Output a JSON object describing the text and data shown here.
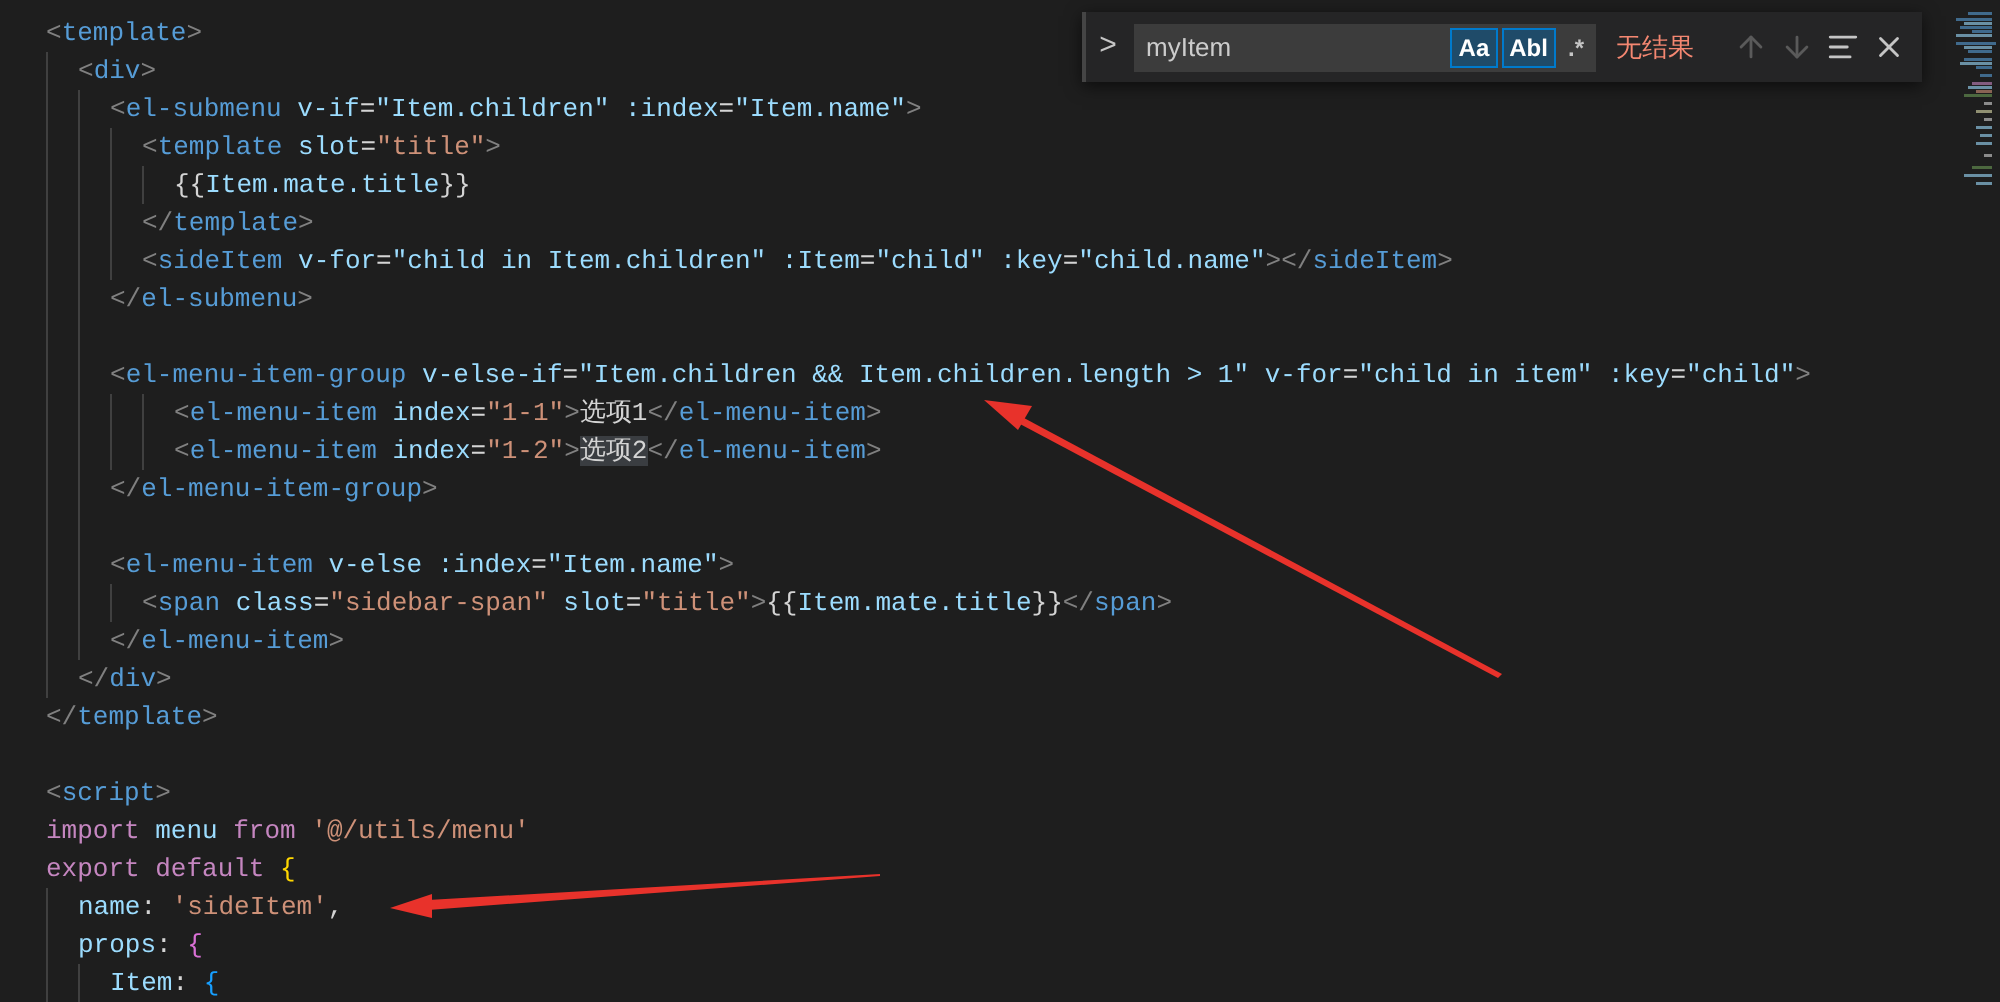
{
  "editor": {
    "lines": [
      {
        "tokens": [
          {
            "kind": "punct",
            "text": "<"
          },
          {
            "kind": "tag",
            "text": "template"
          },
          {
            "kind": "punct",
            "text": ">"
          }
        ],
        "children": [
          {
            "tokens": [
              {
                "kind": "punct",
                "text": "<"
              },
              {
                "kind": "tag",
                "text": "div"
              },
              {
                "kind": "punct",
                "text": ">"
              }
            ],
            "children": [
              {
                "tokens": [
                  {
                    "kind": "punct",
                    "text": "<"
                  },
                  {
                    "kind": "tag",
                    "text": "el-submenu"
                  },
                  {
                    "kind": "attr",
                    "text": " v-if"
                  },
                  {
                    "kind": "plain",
                    "text": "="
                  },
                  {
                    "kind": "expr",
                    "text": "\"Item.children\""
                  },
                  {
                    "kind": "attr",
                    "text": " :index"
                  },
                  {
                    "kind": "plain",
                    "text": "="
                  },
                  {
                    "kind": "expr",
                    "text": "\"Item.name\""
                  },
                  {
                    "kind": "punct",
                    "text": ">"
                  }
                ],
                "children": [
                  {
                    "tokens": [
                      {
                        "kind": "punct",
                        "text": "<"
                      },
                      {
                        "kind": "tag",
                        "text": "template"
                      },
                      {
                        "kind": "attr",
                        "text": " slot"
                      },
                      {
                        "kind": "plain",
                        "text": "="
                      },
                      {
                        "kind": "string",
                        "text": "\"title\""
                      },
                      {
                        "kind": "punct",
                        "text": ">"
                      }
                    ],
                    "children": [
                      {
                        "tokens": [
                          {
                            "kind": "plain",
                            "text": "{{"
                          },
                          {
                            "kind": "expr",
                            "text": "Item.mate.title"
                          },
                          {
                            "kind": "plain",
                            "text": "}}"
                          }
                        ]
                      }
                    ]
                  },
                  {
                    "tokens": [
                      {
                        "kind": "punct",
                        "text": "</"
                      },
                      {
                        "kind": "tag",
                        "text": "template"
                      },
                      {
                        "kind": "punct",
                        "text": ">"
                      }
                    ]
                  },
                  {
                    "tokens": [
                      {
                        "kind": "punct",
                        "text": "<"
                      },
                      {
                        "kind": "tag",
                        "text": "sideItem"
                      },
                      {
                        "kind": "attr",
                        "text": " v-for"
                      },
                      {
                        "kind": "plain",
                        "text": "="
                      },
                      {
                        "kind": "expr",
                        "text": "\"child in Item.children\""
                      },
                      {
                        "kind": "attr",
                        "text": " :Item"
                      },
                      {
                        "kind": "plain",
                        "text": "="
                      },
                      {
                        "kind": "expr",
                        "text": "\"child\""
                      },
                      {
                        "kind": "attr",
                        "text": " :key"
                      },
                      {
                        "kind": "plain",
                        "text": "="
                      },
                      {
                        "kind": "expr",
                        "text": "\"child.name\""
                      },
                      {
                        "kind": "punct",
                        "text": "></"
                      },
                      {
                        "kind": "tag",
                        "text": "sideItem"
                      },
                      {
                        "kind": "punct",
                        "text": ">"
                      }
                    ]
                  }
                ]
              },
              {
                "tokens": [
                  {
                    "kind": "punct",
                    "text": "</"
                  },
                  {
                    "kind": "tag",
                    "text": "el-submenu"
                  },
                  {
                    "kind": "punct",
                    "text": ">"
                  }
                ]
              },
              {
                "blank_before": true,
                "tokens": [
                  {
                    "kind": "punct",
                    "text": "<"
                  },
                  {
                    "kind": "tag",
                    "text": "el-menu-item-group"
                  },
                  {
                    "kind": "attr",
                    "text": " v-else-if"
                  },
                  {
                    "kind": "plain",
                    "text": "="
                  },
                  {
                    "kind": "expr",
                    "text": "\"Item.children && Item.children.length > 1\""
                  },
                  {
                    "kind": "attr",
                    "text": " v-for"
                  },
                  {
                    "kind": "plain",
                    "text": "="
                  },
                  {
                    "kind": "expr",
                    "text": "\"child in item\""
                  },
                  {
                    "kind": "attr",
                    "text": " :key"
                  },
                  {
                    "kind": "plain",
                    "text": "="
                  },
                  {
                    "kind": "expr",
                    "text": "\"child\""
                  },
                  {
                    "kind": "punct",
                    "text": ">"
                  }
                ],
                "children": [
                  {
                    "children": [
                      {
                        "tokens": [
                          {
                            "kind": "punct",
                            "text": "<"
                          },
                          {
                            "kind": "tag",
                            "text": "el-menu-item"
                          },
                          {
                            "kind": "attr",
                            "text": " index"
                          },
                          {
                            "kind": "plain",
                            "text": "="
                          },
                          {
                            "kind": "string",
                            "text": "\"1-1\""
                          },
                          {
                            "kind": "punct",
                            "text": ">"
                          },
                          {
                            "kind": "plain",
                            "text": "选项1"
                          },
                          {
                            "kind": "punct",
                            "text": "</"
                          },
                          {
                            "kind": "tag",
                            "text": "el-menu-item"
                          },
                          {
                            "kind": "punct",
                            "text": ">"
                          }
                        ]
                      },
                      {
                        "tokens": [
                          {
                            "kind": "punct",
                            "text": "<"
                          },
                          {
                            "kind": "tag",
                            "text": "el-menu-item"
                          },
                          {
                            "kind": "attr",
                            "text": " index"
                          },
                          {
                            "kind": "plain",
                            "text": "="
                          },
                          {
                            "kind": "string",
                            "text": "\"1-2\""
                          },
                          {
                            "kind": "punct",
                            "text": ">"
                          },
                          {
                            "kind": "match",
                            "text": "选项2"
                          },
                          {
                            "kind": "punct",
                            "text": "</"
                          },
                          {
                            "kind": "tag",
                            "text": "el-menu-item"
                          },
                          {
                            "kind": "punct",
                            "text": ">"
                          }
                        ]
                      }
                    ]
                  }
                ]
              },
              {
                "tokens": [
                  {
                    "kind": "punct",
                    "text": "</"
                  },
                  {
                    "kind": "tag",
                    "text": "el-menu-item-group"
                  },
                  {
                    "kind": "punct",
                    "text": ">"
                  }
                ]
              },
              {
                "blank_before": true,
                "tokens": [
                  {
                    "kind": "punct",
                    "text": "<"
                  },
                  {
                    "kind": "tag",
                    "text": "el-menu-item"
                  },
                  {
                    "kind": "attr",
                    "text": " v-else"
                  },
                  {
                    "kind": "attr",
                    "text": " :index"
                  },
                  {
                    "kind": "plain",
                    "text": "="
                  },
                  {
                    "kind": "expr",
                    "text": "\"Item.name\""
                  },
                  {
                    "kind": "punct",
                    "text": ">"
                  }
                ],
                "children": [
                  {
                    "tokens": [
                      {
                        "kind": "punct",
                        "text": "<"
                      },
                      {
                        "kind": "tag",
                        "text": "span"
                      },
                      {
                        "kind": "attr",
                        "text": " class"
                      },
                      {
                        "kind": "plain",
                        "text": "="
                      },
                      {
                        "kind": "string",
                        "text": "\"sidebar-span\""
                      },
                      {
                        "kind": "attr",
                        "text": " slot"
                      },
                      {
                        "kind": "plain",
                        "text": "="
                      },
                      {
                        "kind": "string",
                        "text": "\"title\""
                      },
                      {
                        "kind": "punct",
                        "text": ">"
                      },
                      {
                        "kind": "plain",
                        "text": "{{"
                      },
                      {
                        "kind": "expr",
                        "text": "Item.mate.title"
                      },
                      {
                        "kind": "plain",
                        "text": "}}"
                      },
                      {
                        "kind": "punct",
                        "text": "</"
                      },
                      {
                        "kind": "tag",
                        "text": "span"
                      },
                      {
                        "kind": "punct",
                        "text": ">"
                      }
                    ]
                  }
                ]
              },
              {
                "tokens": [
                  {
                    "kind": "punct",
                    "text": "</"
                  },
                  {
                    "kind": "tag",
                    "text": "el-menu-item"
                  },
                  {
                    "kind": "punct",
                    "text": ">"
                  }
                ]
              }
            ]
          },
          {
            "tokens": [
              {
                "kind": "punct",
                "text": "</"
              },
              {
                "kind": "tag",
                "text": "div"
              },
              {
                "kind": "punct",
                "text": ">"
              }
            ]
          }
        ]
      },
      {
        "tokens": [
          {
            "kind": "punct",
            "text": "</"
          },
          {
            "kind": "tag",
            "text": "template"
          },
          {
            "kind": "punct",
            "text": ">"
          }
        ]
      },
      {
        "blank_before": true,
        "tokens": [
          {
            "kind": "punct",
            "text": "<"
          },
          {
            "kind": "tag",
            "text": "script"
          },
          {
            "kind": "punct",
            "text": ">"
          }
        ]
      },
      {
        "tokens": [
          {
            "kind": "keyword",
            "text": "import"
          },
          {
            "kind": "variable",
            "text": " menu"
          },
          {
            "kind": "keyword",
            "text": " from"
          },
          {
            "kind": "string",
            "text": " '@/utils/menu'"
          }
        ]
      },
      {
        "tokens": [
          {
            "kind": "keyword",
            "text": "export"
          },
          {
            "kind": "keyword",
            "text": " default"
          },
          {
            "kind": "brace1",
            "text": " {"
          }
        ],
        "children": [
          {
            "tokens": [
              {
                "kind": "variable",
                "text": "name"
              },
              {
                "kind": "plain",
                "text": ":"
              },
              {
                "kind": "string",
                "text": " 'sideItem'"
              },
              {
                "kind": "plain",
                "text": ","
              }
            ]
          },
          {
            "tokens": [
              {
                "kind": "variable",
                "text": "props"
              },
              {
                "kind": "plain",
                "text": ":"
              },
              {
                "kind": "brace2",
                "text": " {"
              }
            ],
            "children": [
              {
                "tokens": [
                  {
                    "kind": "variable",
                    "text": "Item"
                  },
                  {
                    "kind": "plain",
                    "text": ":"
                  },
                  {
                    "kind": "brace3",
                    "text": " {"
                  }
                ]
              }
            ]
          }
        ]
      }
    ]
  },
  "find_widget": {
    "toggle": ">",
    "value": "myItem",
    "options": [
      {
        "label": "Aa",
        "selected": true
      },
      {
        "label": "Abl",
        "selected": true
      },
      {
        "label": ".*",
        "selected": false
      }
    ],
    "result": "无结果"
  }
}
